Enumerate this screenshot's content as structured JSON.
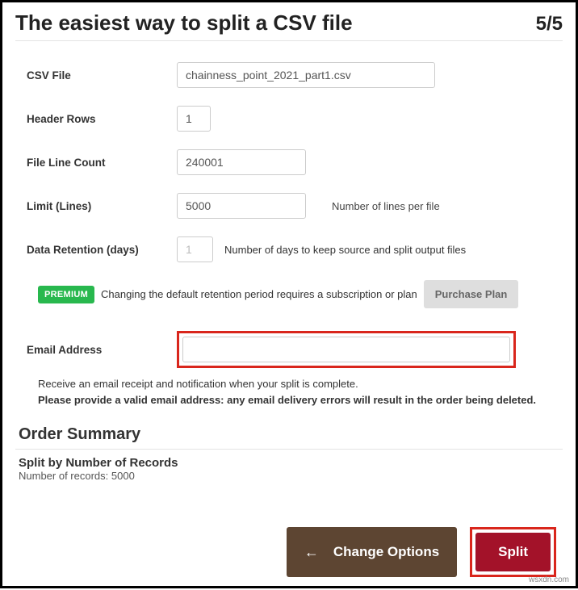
{
  "header": {
    "title": "The easiest way to split a CSV file",
    "step": "5/5"
  },
  "form": {
    "csv_file": {
      "label": "CSV File",
      "value": "chainness_point_2021_part1.csv"
    },
    "header_rows": {
      "label": "Header Rows",
      "value": "1"
    },
    "file_line_count": {
      "label": "File Line Count",
      "value": "240001"
    },
    "limit": {
      "label": "Limit (Lines)",
      "value": "5000",
      "hint": "Number of lines per file"
    },
    "data_retention": {
      "label": "Data Retention (days)",
      "value": "1",
      "hint": "Number of days to keep source and split output files"
    },
    "email": {
      "label": "Email Address",
      "value": ""
    }
  },
  "premium": {
    "badge": "PREMIUM",
    "text": "Changing the default retention period requires a subscription or plan",
    "button": "Purchase Plan"
  },
  "notice": {
    "line1": "Receive an email receipt and notification when your split is complete.",
    "line2": "Please provide a valid email address: any email delivery errors will result in the order being deleted."
  },
  "order": {
    "heading": "Order Summary",
    "title": "Split by Number of Records",
    "sub": "Number of records: 5000"
  },
  "actions": {
    "change": "Change Options",
    "split": "Split"
  },
  "source_watermark": "wsxdn.com"
}
